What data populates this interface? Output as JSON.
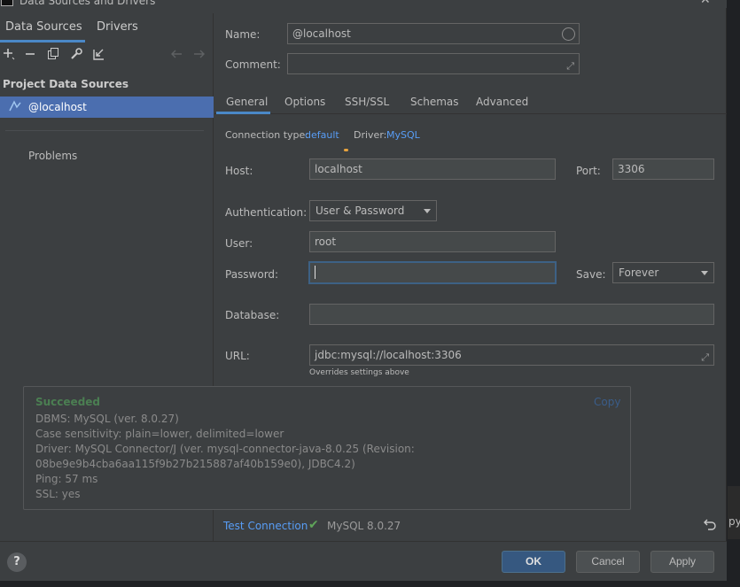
{
  "window": {
    "title": "Data Sources and Drivers",
    "close": "✕"
  },
  "left": {
    "tabs": [
      "Data Sources",
      "Drivers"
    ],
    "section_title": "Project Data Sources",
    "selected_item": "@localhost",
    "problems": "Problems"
  },
  "form": {
    "name_label": "Name:",
    "name_value": "@localhost",
    "comment_label": "Comment:",
    "comment_value": "",
    "tabs": [
      "General",
      "Options",
      "SSH/SSL",
      "Schemas",
      "Advanced"
    ],
    "connection_type_label": "Connection type:",
    "connection_type_value": "default",
    "driver_label": "Driver:",
    "driver_value": "MySQL",
    "host_label": "Host:",
    "host_value": "localhost",
    "port_label": "Port:",
    "port_value": "3306",
    "auth_label": "Authentication:",
    "auth_value": "User & Password",
    "user_label": "User:",
    "user_value": "root",
    "password_label": "Password:",
    "password_value": "",
    "save_label": "Save:",
    "save_value": "Forever",
    "database_label": "Database:",
    "database_value": "",
    "url_label": "URL:",
    "url_value": "jdbc:mysql://localhost:3306",
    "url_note": "Overrides settings above"
  },
  "popup": {
    "status": "Succeeded",
    "copy": "Copy",
    "lines": [
      "DBMS: MySQL (ver. 8.0.27)",
      "Case sensitivity: plain=lower, delimited=lower",
      "Driver: MySQL Connector/J (ver. mysql-connector-java-8.0.25 (Revision:",
      "08be9e9b4cba6aa115f9b27b215887af40b159e0), JDBC4.2)",
      "Ping: 57 ms",
      "SSL: yes"
    ]
  },
  "bottom": {
    "test_connection": "Test Connection",
    "test_result": "MySQL 8.0.27"
  },
  "footer": {
    "help": "?",
    "ok": "OK",
    "cancel": "Cancel",
    "apply": "Apply"
  },
  "side_text": "py",
  "colors": {
    "accent": "#4a88c7",
    "link": "#589df6",
    "selection": "#4b6eaf",
    "success": "#4b7f52",
    "primary_button": "#365880"
  }
}
